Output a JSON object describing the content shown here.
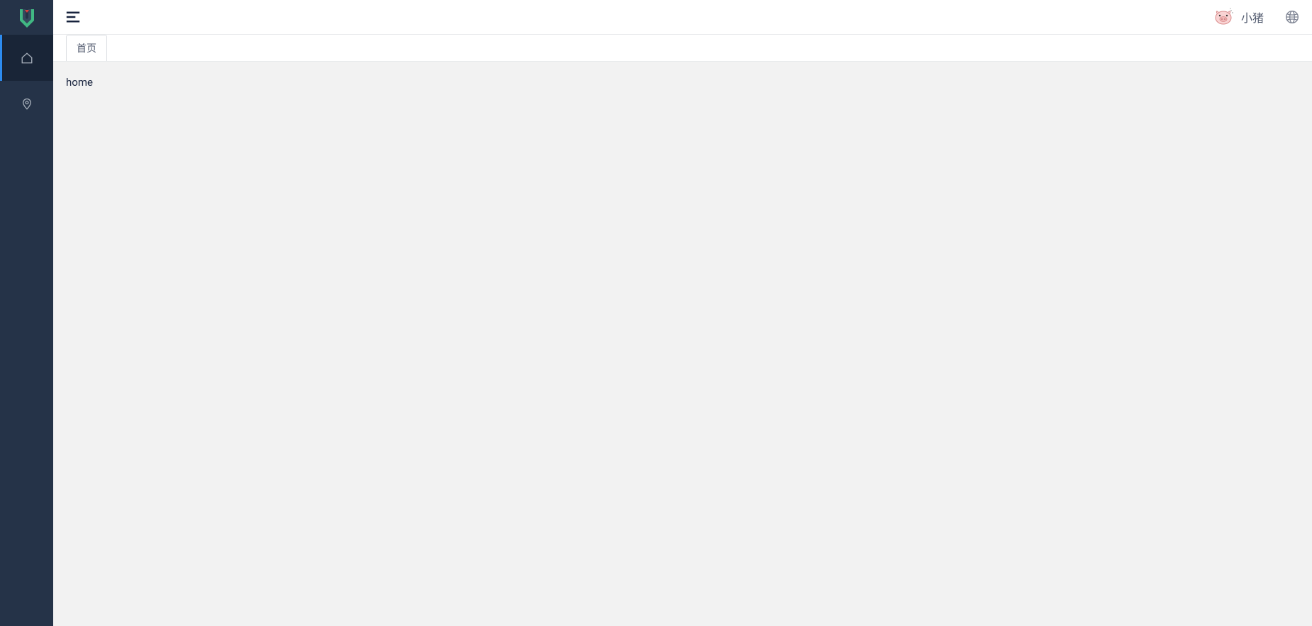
{
  "sidebar": {
    "items": [
      {
        "icon": "home-icon",
        "active": true
      },
      {
        "icon": "location-icon",
        "active": false
      }
    ]
  },
  "header": {
    "username": "小猪"
  },
  "tabs": [
    {
      "label": "首页"
    }
  ],
  "content": {
    "text": "home"
  }
}
